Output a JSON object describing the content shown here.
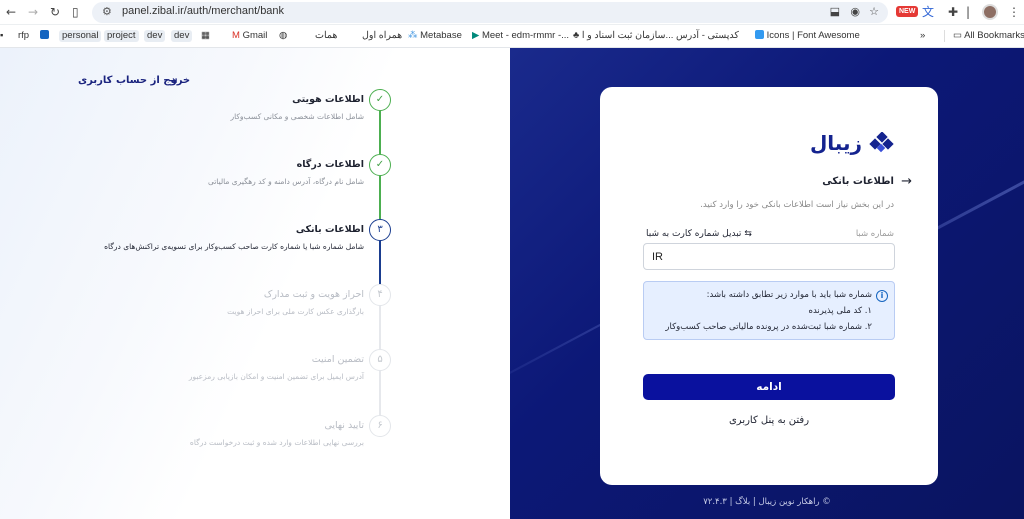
{
  "browser": {
    "url": "panel.zibal.ir/auth/merchant/bank",
    "bookmarks": [
      "rfp",
      "personal",
      "project",
      "dev",
      "dev",
      "Gmail",
      "همات",
      "همراه اول",
      "Metabase",
      "Meet - edm-rmmr -...",
      "سازمان ثبت اسناد و ا...",
      "کدپستی - آدرس",
      "Icons | Font Awesome"
    ],
    "all_bookmarks": "All Bookmarks",
    "new_badge": "NEW"
  },
  "sidebar": {
    "exit_label": "خروج از حساب کاربری",
    "steps": [
      {
        "num": "✓",
        "title": "اطلاعات هویتی",
        "subtitle": "شامل اطلاعات شخصی و مکانی کسب‌وکار",
        "state": "done"
      },
      {
        "num": "✓",
        "title": "اطلاعات درگاه",
        "subtitle": "شامل نام درگاه، آدرس دامنه و کد رهگیری مالیاتی",
        "state": "done"
      },
      {
        "num": "۳",
        "title": "اطلاعات بانکی",
        "subtitle": "شامل شماره شبا یا شماره کارت صاحب کسب‌وکار برای تسویه‌ی تراکنش‌های درگاه",
        "state": "current"
      },
      {
        "num": "۴",
        "title": "احراز هویت و ثبت مدارک",
        "subtitle": "بارگذاری عکس کارت ملی برای احراز هویت",
        "state": "future"
      },
      {
        "num": "۵",
        "title": "تضمین امنیت",
        "subtitle": "آدرس ایمیل برای تضمین امنیت و امکان بازیابی رمزعبور",
        "state": "future"
      },
      {
        "num": "۶",
        "title": "تایید نهایی",
        "subtitle": "بررسی نهایی اطلاعات وارد شده و ثبت درخواست درگاه",
        "state": "future"
      }
    ]
  },
  "card": {
    "logo_text": "زیبال",
    "back_title": "اطلاعات بانکی",
    "hint": "در این بخش نیاز است اطلاعات بانکی خود را وارد کنید.",
    "field_label": "شماره شبا",
    "convert_label": "تبدیل شماره کارت به شبا",
    "iban_value": "IR",
    "note": {
      "heading": "شماره شبا باید با موارد زیر تطابق داشته باشد:",
      "items": [
        "۱. کد ملی پذیرنده",
        "۲. شماره شبا ثبت‌شده در پرونده مالیاتی صاحب کسب‌وکار"
      ]
    },
    "continue_label": "ادامه",
    "panel_link": "رفتن به پنل کاربری"
  },
  "footer": "© راهکار نوین زیبال | بلاگ | ۷۲.۴.۳",
  "colors": {
    "primary": "#0a119e",
    "dark_bg": "#0c1877",
    "done": "#4caf50",
    "note_bg": "#e6efff"
  }
}
